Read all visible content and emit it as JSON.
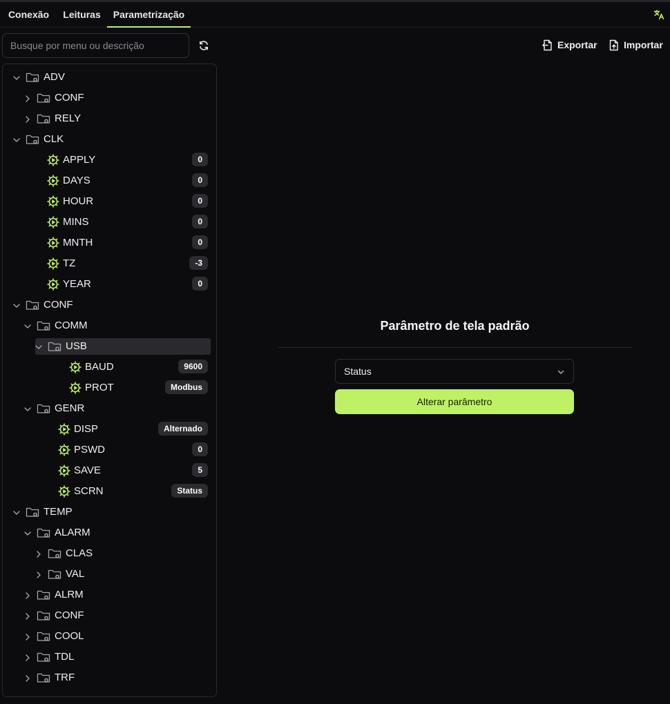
{
  "tabs": [
    {
      "label": "Conexão",
      "active": false
    },
    {
      "label": "Leituras",
      "active": false
    },
    {
      "label": "Parametrização",
      "active": true
    }
  ],
  "search": {
    "placeholder": "Busque por menu ou descrição"
  },
  "toolbar": {
    "export_label": "Exportar",
    "import_label": "Importar"
  },
  "tree": [
    {
      "label": "ADV",
      "type": "folder",
      "depth": 0,
      "expanded": true
    },
    {
      "label": "CONF",
      "type": "folder",
      "depth": 1,
      "expanded": false
    },
    {
      "label": "RELY",
      "type": "folder",
      "depth": 1,
      "expanded": false
    },
    {
      "label": "CLK",
      "type": "folder",
      "depth": 0,
      "expanded": true
    },
    {
      "label": "APPLY",
      "type": "param",
      "depth": 1,
      "value": "0"
    },
    {
      "label": "DAYS",
      "type": "param",
      "depth": 1,
      "value": "0"
    },
    {
      "label": "HOUR",
      "type": "param",
      "depth": 1,
      "value": "0"
    },
    {
      "label": "MINS",
      "type": "param",
      "depth": 1,
      "value": "0"
    },
    {
      "label": "MNTH",
      "type": "param",
      "depth": 1,
      "value": "0"
    },
    {
      "label": "TZ",
      "type": "param",
      "depth": 1,
      "value": "-3"
    },
    {
      "label": "YEAR",
      "type": "param",
      "depth": 1,
      "value": "0"
    },
    {
      "label": "CONF",
      "type": "folder",
      "depth": 0,
      "expanded": true
    },
    {
      "label": "COMM",
      "type": "folder",
      "depth": 1,
      "expanded": true
    },
    {
      "label": "USB",
      "type": "folder",
      "depth": 2,
      "expanded": true,
      "selected": true
    },
    {
      "label": "BAUD",
      "type": "param",
      "depth": 3,
      "value": "9600"
    },
    {
      "label": "PROT",
      "type": "param",
      "depth": 3,
      "value": "Modbus"
    },
    {
      "label": "GENR",
      "type": "folder",
      "depth": 1,
      "expanded": true
    },
    {
      "label": "DISP",
      "type": "param",
      "depth": 2,
      "value": "Alternado"
    },
    {
      "label": "PSWD",
      "type": "param",
      "depth": 2,
      "value": "0"
    },
    {
      "label": "SAVE",
      "type": "param",
      "depth": 2,
      "value": "5"
    },
    {
      "label": "SCRN",
      "type": "param",
      "depth": 2,
      "value": "Status"
    },
    {
      "label": "TEMP",
      "type": "folder",
      "depth": 0,
      "expanded": true
    },
    {
      "label": "ALARM",
      "type": "folder",
      "depth": 1,
      "expanded": true
    },
    {
      "label": "CLAS",
      "type": "folder",
      "depth": 2,
      "expanded": false
    },
    {
      "label": "VAL",
      "type": "folder",
      "depth": 2,
      "expanded": false
    },
    {
      "label": "ALRM",
      "type": "folder",
      "depth": 1,
      "expanded": false
    },
    {
      "label": "CONF",
      "type": "folder",
      "depth": 1,
      "expanded": false
    },
    {
      "label": "COOL",
      "type": "folder",
      "depth": 1,
      "expanded": false
    },
    {
      "label": "TDL",
      "type": "folder",
      "depth": 1,
      "expanded": false
    },
    {
      "label": "TRF",
      "type": "folder",
      "depth": 1,
      "expanded": false
    }
  ],
  "panel": {
    "title": "Parâmetro de tela padrão",
    "select_value": "Status",
    "apply_label": "Alterar parâmetro"
  },
  "colors": {
    "accent": "#bef264",
    "background": "#0c0c0e",
    "badge": "#2b2b30"
  },
  "icons": {
    "folder": "folder-gear-icon",
    "param": "gear-play-icon",
    "translate": "translate-icon",
    "refresh": "refresh-icon"
  }
}
